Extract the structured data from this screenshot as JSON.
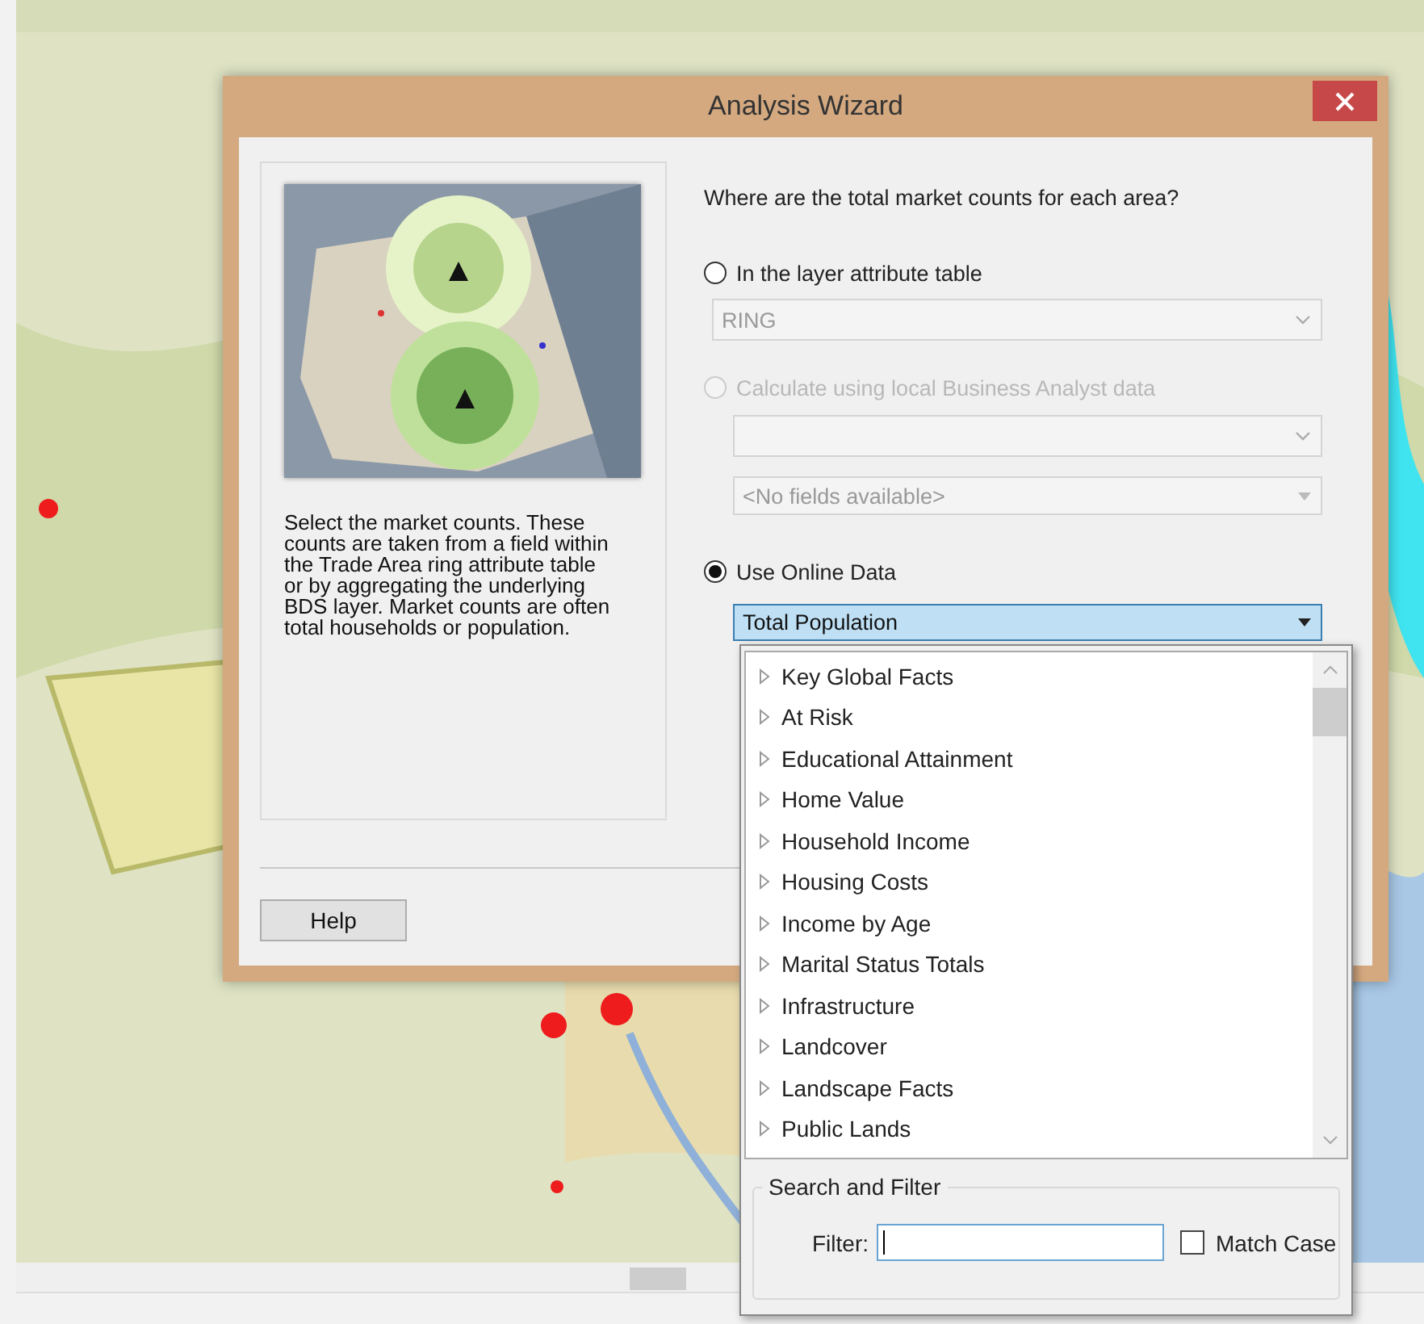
{
  "dialog": {
    "title": "Analysis Wizard",
    "info_panel": {
      "description": "Select the market counts. These counts are taken from a field within the Trade Area ring attribute table or by aggregating the underlying BDS layer. Market counts are often total households or population."
    },
    "question": "Where are the total market counts for each area?",
    "options": [
      {
        "label": "In the layer attribute table",
        "selected": false,
        "disabled": false,
        "combos": [
          {
            "value": "RING",
            "disabled": true,
            "kind": "chevron"
          }
        ]
      },
      {
        "label": "Calculate using local Business Analyst data",
        "selected": false,
        "disabled": true,
        "combos": [
          {
            "disabled": true,
            "kind": "chevron"
          },
          {
            "value": "<No fields available>",
            "disabled": true,
            "kind": "triangle"
          }
        ]
      },
      {
        "label": "Use Online Data",
        "selected": true,
        "disabled": false,
        "combos": [
          {
            "value": "Total Population",
            "disabled": false,
            "kind": "triangle",
            "open": true
          }
        ]
      }
    ],
    "buttons": [
      {
        "label": "Help"
      }
    ]
  },
  "dropdown": {
    "items": [
      {
        "label": "Key Global Facts",
        "expanded": false
      },
      {
        "label": "At Risk",
        "expanded": false
      },
      {
        "label": "Educational Attainment",
        "expanded": false
      },
      {
        "label": "Home Value",
        "expanded": false
      },
      {
        "label": "Household Income",
        "expanded": false
      },
      {
        "label": "Housing Costs",
        "expanded": false
      },
      {
        "label": "Income by Age",
        "expanded": false
      },
      {
        "label": "Marital Status Totals",
        "expanded": false
      },
      {
        "label": "Infrastructure",
        "expanded": false
      },
      {
        "label": "Landcover",
        "expanded": false
      },
      {
        "label": "Landscape Facts",
        "expanded": false
      },
      {
        "label": "Public Lands",
        "expanded": false
      }
    ],
    "search": {
      "title": "Search and Filter",
      "filter_label": "Filter:",
      "match_case": {
        "label": "Match Case",
        "checked": false
      }
    }
  }
}
